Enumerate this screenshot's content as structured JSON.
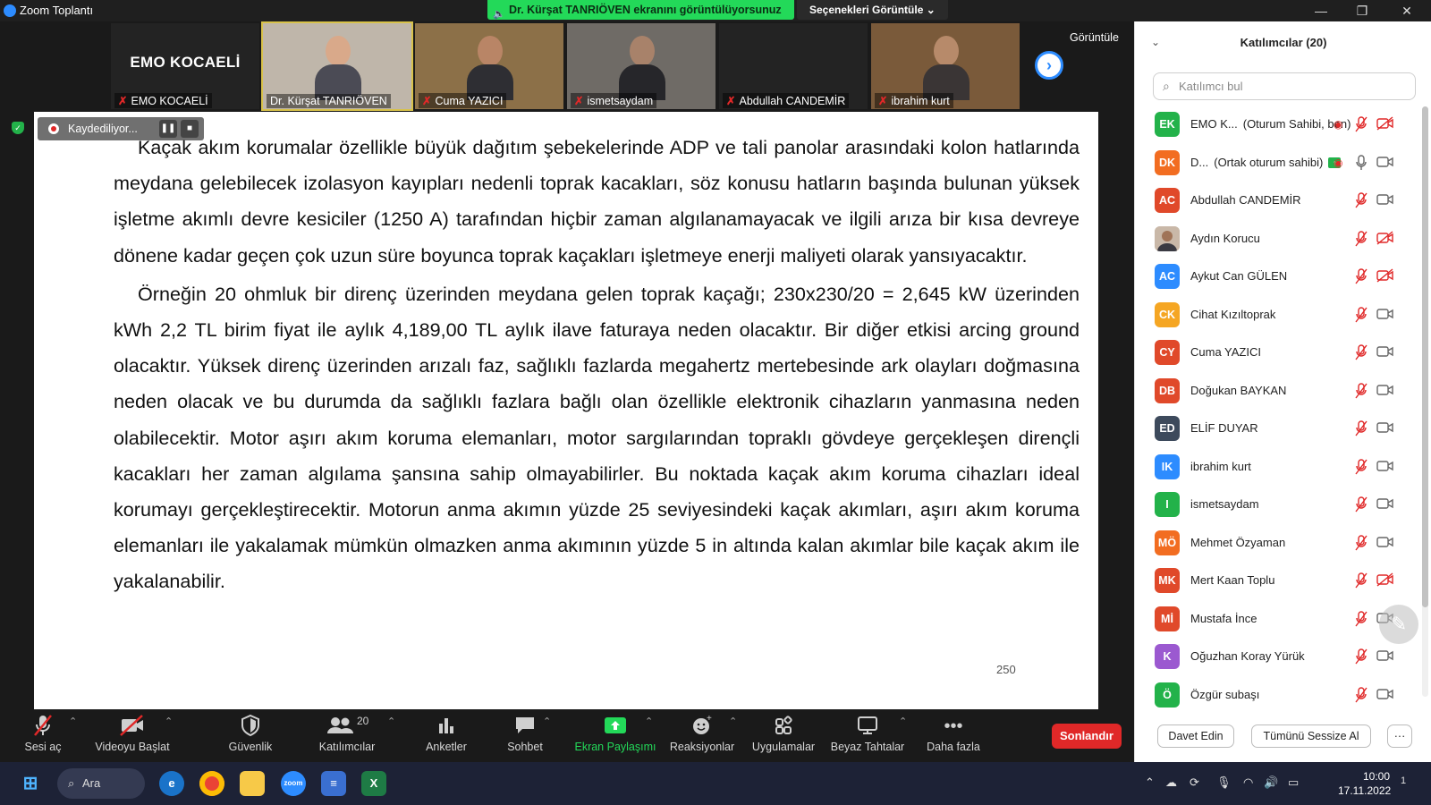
{
  "window": {
    "title": "Zoom Toplantı"
  },
  "share_banner": {
    "text": "Dr. Kürşat TANRIÖVEN ekranını görüntülüyorsunuz",
    "options": "Seçenekleri Görüntüle ⌄"
  },
  "window_controls": {
    "minimize": "—",
    "restore": "❐",
    "close": "✕"
  },
  "thumbnails": [
    {
      "name": "EMO KOCAELİ",
      "big_text": "EMO KOCAELİ",
      "muted": true
    },
    {
      "name": "Dr. Kürşat TANRIÖVEN",
      "muted": false,
      "active": true
    },
    {
      "name": "Cuma YAZICI",
      "muted": true
    },
    {
      "name": "ismetsaydam",
      "muted": true
    },
    {
      "name": "Abdullah CANDEMİR",
      "muted": true
    },
    {
      "name": "ibrahim kurt",
      "muted": true
    }
  ],
  "gallery_view_label": "Görüntüle",
  "next_icon": "›",
  "recording": {
    "label": "Kaydediliyor...",
    "pause": "❚❚",
    "stop": "■"
  },
  "document": {
    "paragraphs": [
      "Kaçak akım korumalar özellikle büyük dağıtım şebekelerinde ADP ve tali panolar arasındaki kolon hatlarında meydana gelebilecek izolasyon kayıpları nedenli toprak kacakları, söz konusu hatların başında bulunan yüksek işletme akımlı devre kesiciler (1250 A) tarafından hiçbir zaman algılanamayacak ve ilgili arıza bir kısa devreye dönene kadar geçen çok uzun süre boyunca toprak kaçakları işletmeye enerji maliyeti olarak yansıyacaktır.",
      "Örneğin 20 ohmluk bir direnç üzerinden meydana gelen toprak kaçağı; 230x230/20 = 2,645 kW üzerinden kWh 2,2 TL birim fiyat ile aylık 4,189,00 TL aylık ilave faturaya neden olacaktır. Bir diğer etkisi arcing ground olacaktır. Yüksek direnç üzerinden arızalı faz, sağlıklı fazlarda megahertz mertebesinde ark olayları doğmasına neden olacak ve bu durumda da sağlıklı fazlara bağlı olan özellikle elektronik cihazların yanmasına neden olabilecektir. Motor aşırı akım koruma elemanları, motor sargılarından topraklı gövdeye gerçekleşen dirençli kacakları her zaman algılama şansına sahip olmayabilirler. Bu noktada kaçak akım koruma cihazları ideal korumayı gerçekleştirecektir. Motorun anma akımın yüzde 25 seviyesindeki kaçak akımları, aşırı akım koruma elemanları ile yakalamak mümkün olmazken anma akımının yüzde 5 in altında kalan akımlar bile kaçak akım ile yakalanabilir."
    ],
    "page_number": "250"
  },
  "toolbar": {
    "mute": "Sesi aç",
    "video": "Videoyu Başlat",
    "security": "Güvenlik",
    "participants": "Katılımcılar",
    "participants_count": "20",
    "polls": "Anketler",
    "chat": "Sohbet",
    "share": "Ekran Paylaşımı",
    "reactions": "Reaksiyonlar",
    "apps": "Uygulamalar",
    "whiteboards": "Beyaz Tahtalar",
    "more": "Daha fazla",
    "end": "Sonlandır"
  },
  "panel": {
    "title": "Katılımcılar (20)",
    "search_placeholder": "Katılımcı bul",
    "participants": [
      {
        "initials": "EK",
        "color": "#23b24a",
        "name": "EMO K...",
        "role": "(Oturum Sahibi, ben)",
        "rec": true,
        "mic": "off",
        "cam": "off"
      },
      {
        "initials": "DK",
        "color": "#f26d21",
        "name": "D...",
        "role": "(Ortak oturum sahibi)",
        "sharing": true,
        "rec": true,
        "mic": "on",
        "cam": "on"
      },
      {
        "initials": "AC",
        "color": "#e0492a",
        "name": "Abdullah CANDEMİR",
        "mic": "off",
        "cam": "on"
      },
      {
        "initials": "",
        "photo": true,
        "color": "#c9b8a8",
        "name": "Aydın Korucu",
        "mic": "off",
        "cam": "off"
      },
      {
        "initials": "AC",
        "color": "#2d8cff",
        "name": "Aykut Can GÜLEN",
        "mic": "off",
        "cam": "off"
      },
      {
        "initials": "CK",
        "color": "#f5a623",
        "name": "Cihat Kızıltoprak",
        "mic": "off",
        "cam": "on"
      },
      {
        "initials": "CY",
        "color": "#e0492a",
        "name": "Cuma YAZICI",
        "mic": "off",
        "cam": "on"
      },
      {
        "initials": "DB",
        "color": "#e0492a",
        "name": "Doğukan BAYKAN",
        "mic": "off",
        "cam": "on"
      },
      {
        "initials": "ED",
        "color": "#3d4a5c",
        "name": "ELİF DUYAR",
        "mic": "off",
        "cam": "on"
      },
      {
        "initials": "IK",
        "color": "#2d8cff",
        "name": "ibrahim kurt",
        "mic": "off",
        "cam": "on"
      },
      {
        "initials": "I",
        "color": "#23b24a",
        "name": "ismetsaydam",
        "mic": "off",
        "cam": "on"
      },
      {
        "initials": "MÖ",
        "color": "#f26d21",
        "name": "Mehmet Özyaman",
        "mic": "off",
        "cam": "on"
      },
      {
        "initials": "MK",
        "color": "#e0492a",
        "name": "Mert Kaan Toplu",
        "mic": "off",
        "cam": "off"
      },
      {
        "initials": "Mİ",
        "color": "#e0492a",
        "name": "Mustafa İnce",
        "mic": "off",
        "cam": "on"
      },
      {
        "initials": "K",
        "color": "#9b59d0",
        "name": "Oğuzhan Koray Yürük",
        "mic": "off",
        "cam": "on"
      },
      {
        "initials": "Ö",
        "color": "#23b24a",
        "name": "Özgür subaşı",
        "mic": "off",
        "cam": "on"
      }
    ],
    "invite": "Davet Edin",
    "mute_all": "Tümünü Sessize Al",
    "more": "···"
  },
  "taskbar": {
    "search": "Ara",
    "time": "10:00",
    "date": "17.11.2022",
    "notifications": "1"
  }
}
